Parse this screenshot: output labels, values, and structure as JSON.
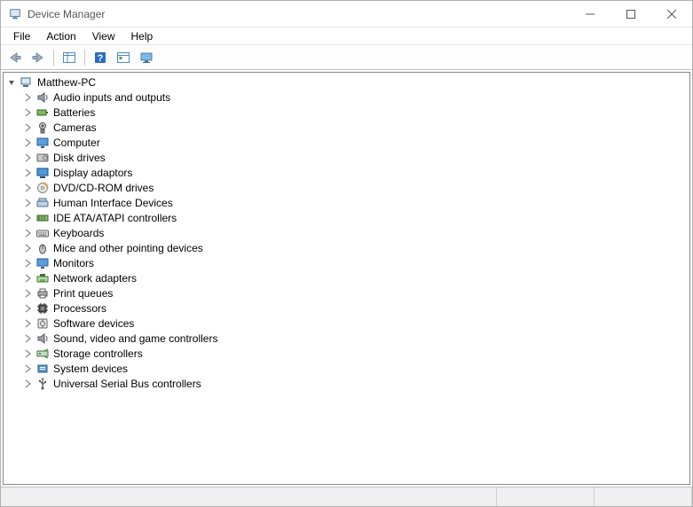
{
  "window": {
    "title": "Device Manager"
  },
  "menu": {
    "file": "File",
    "action": "Action",
    "view": "View",
    "help": "Help"
  },
  "tree": {
    "root": "Matthew-PC",
    "categories": [
      {
        "label": "Audio inputs and outputs",
        "icon": "speaker"
      },
      {
        "label": "Batteries",
        "icon": "battery"
      },
      {
        "label": "Cameras",
        "icon": "camera"
      },
      {
        "label": "Computer",
        "icon": "monitor"
      },
      {
        "label": "Disk drives",
        "icon": "disk"
      },
      {
        "label": "Display adaptors",
        "icon": "display"
      },
      {
        "label": "DVD/CD-ROM drives",
        "icon": "cd"
      },
      {
        "label": "Human Interface Devices",
        "icon": "hid"
      },
      {
        "label": "IDE ATA/ATAPI controllers",
        "icon": "ide"
      },
      {
        "label": "Keyboards",
        "icon": "keyboard"
      },
      {
        "label": "Mice and other pointing devices",
        "icon": "mouse"
      },
      {
        "label": "Monitors",
        "icon": "monitor"
      },
      {
        "label": "Network adapters",
        "icon": "network"
      },
      {
        "label": "Print queues",
        "icon": "printer"
      },
      {
        "label": "Processors",
        "icon": "cpu"
      },
      {
        "label": "Software devices",
        "icon": "software"
      },
      {
        "label": "Sound, video and game controllers",
        "icon": "speaker"
      },
      {
        "label": "Storage controllers",
        "icon": "storage"
      },
      {
        "label": "System devices",
        "icon": "system"
      },
      {
        "label": "Universal Serial Bus controllers",
        "icon": "usb"
      }
    ]
  }
}
